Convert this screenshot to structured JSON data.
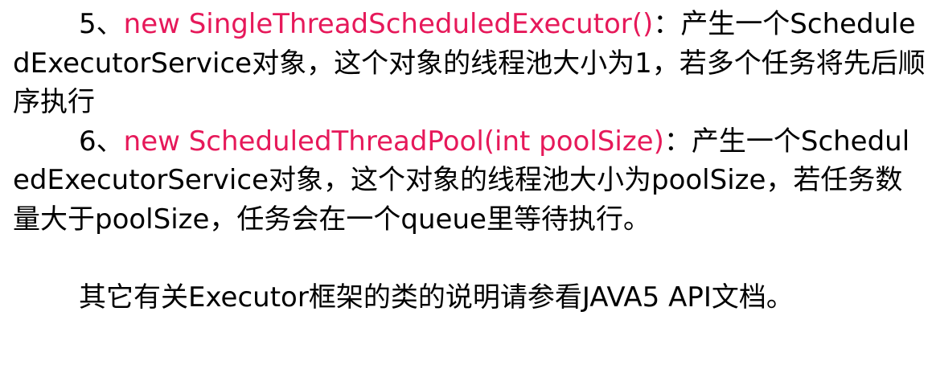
{
  "items": [
    {
      "number": "5、",
      "code": "new SingleThreadScheduledExecutor()",
      "sep": "：",
      "description": "产生一个ScheduledExecutorService对象，这个对象的线程池大小为1，若多个任务将先后顺序执行"
    },
    {
      "number": "6、",
      "code": "new ScheduledThreadPool(int poolSize)",
      "sep": "：",
      "description": "产生一个ScheduledExecutorService对象，这个对象的线程池大小为poolSize，若任务数量大于poolSize，任务会在一个queue里等待执行。"
    }
  ],
  "footer": "其它有关Executor框架的类的说明请参看JAVA5 API文档。",
  "colors": {
    "code_highlight": "#e6195a",
    "text": "#000000",
    "background": "#ffffff"
  }
}
